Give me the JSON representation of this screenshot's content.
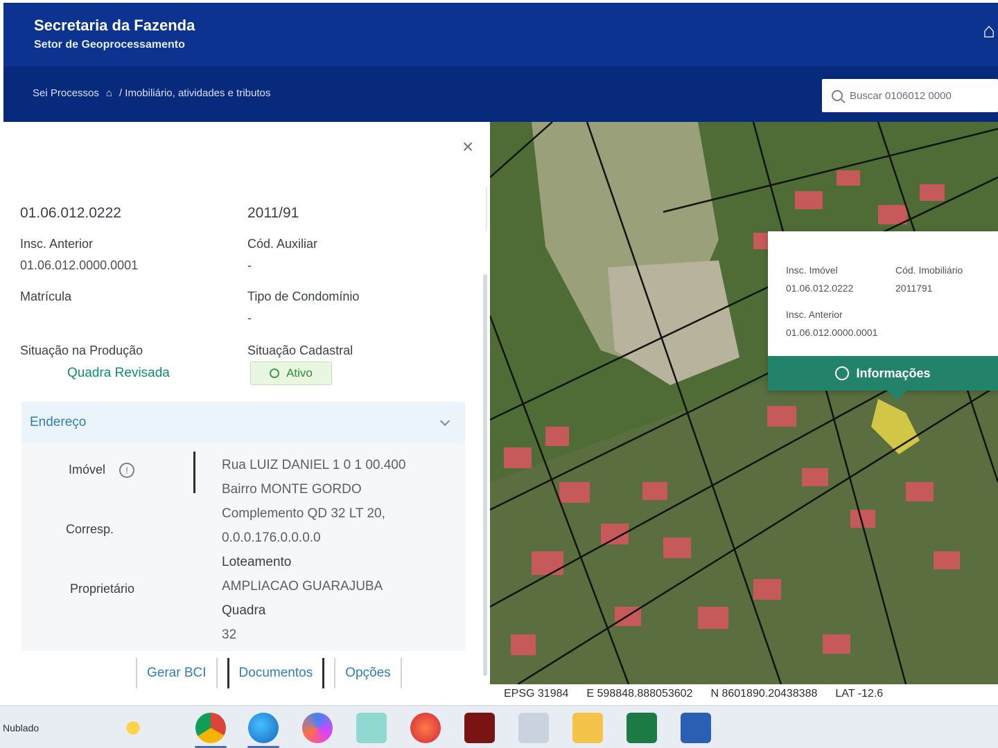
{
  "header": {
    "title": "Secretaria da Fazenda",
    "subtitle": "Setor de Geoprocessamento",
    "breadcrumb_home": "Sei Processos",
    "breadcrumb_path": "/ Imobiliário, atividades e tributos",
    "search_value": "Buscar 0106012 0000"
  },
  "panel": {
    "inscricao": "01.06.012.0222",
    "ano": "2011/91",
    "insc_anterior_label": "Insc. Anterior",
    "insc_anterior_value": "01.06.012.0000.0001",
    "cod_auxiliar_label": "Cód. Auxiliar",
    "cod_auxiliar_value": "-",
    "matricula_label": "Matrícula",
    "tipo_condominio_label": "Tipo de Condomínio",
    "tipo_condominio_value": "-",
    "situacao_producao_label": "Situação na Produção",
    "situacao_producao_value": "Quadra Revisada",
    "situacao_cadastral_label": "Situação Cadastral",
    "situacao_cadastral_value": "Ativo",
    "section_title": "Endereço",
    "tab_imovel": "Imóvel",
    "tab_correspondencia": "Corresp.",
    "tab_proprietario": "Proprietário",
    "address_lines": [
      "Rua LUIZ DANIEL 1 0 1 00.400",
      "Bairro MONTE GORDO",
      "Complemento QD 32 LT 20,",
      "0.0.0.176.0.0.0.0",
      "Loteamento",
      "AMPLIACAO GUARAJUBA",
      "Quadra",
      "32"
    ],
    "actions": [
      "Gerar BCI",
      "Documentos",
      "Opções"
    ]
  },
  "map": {
    "popup": {
      "field1_label": "Insc. Imóvel",
      "field1_value": "01.06.012.0222",
      "field2_label": "Cód. Imobiliário",
      "field2_value": "2011791",
      "field3_label": "Insc. Anterior",
      "field3_value": "01.06.012.0000.0001",
      "button": "Informações"
    },
    "coords": {
      "epsg": "EPSG 31984",
      "e": "E 598848.888053602",
      "n": "N 8601890.20438388",
      "lat": "LAT -12.6"
    }
  },
  "taskbar": {
    "left_text": "Nublado"
  }
}
